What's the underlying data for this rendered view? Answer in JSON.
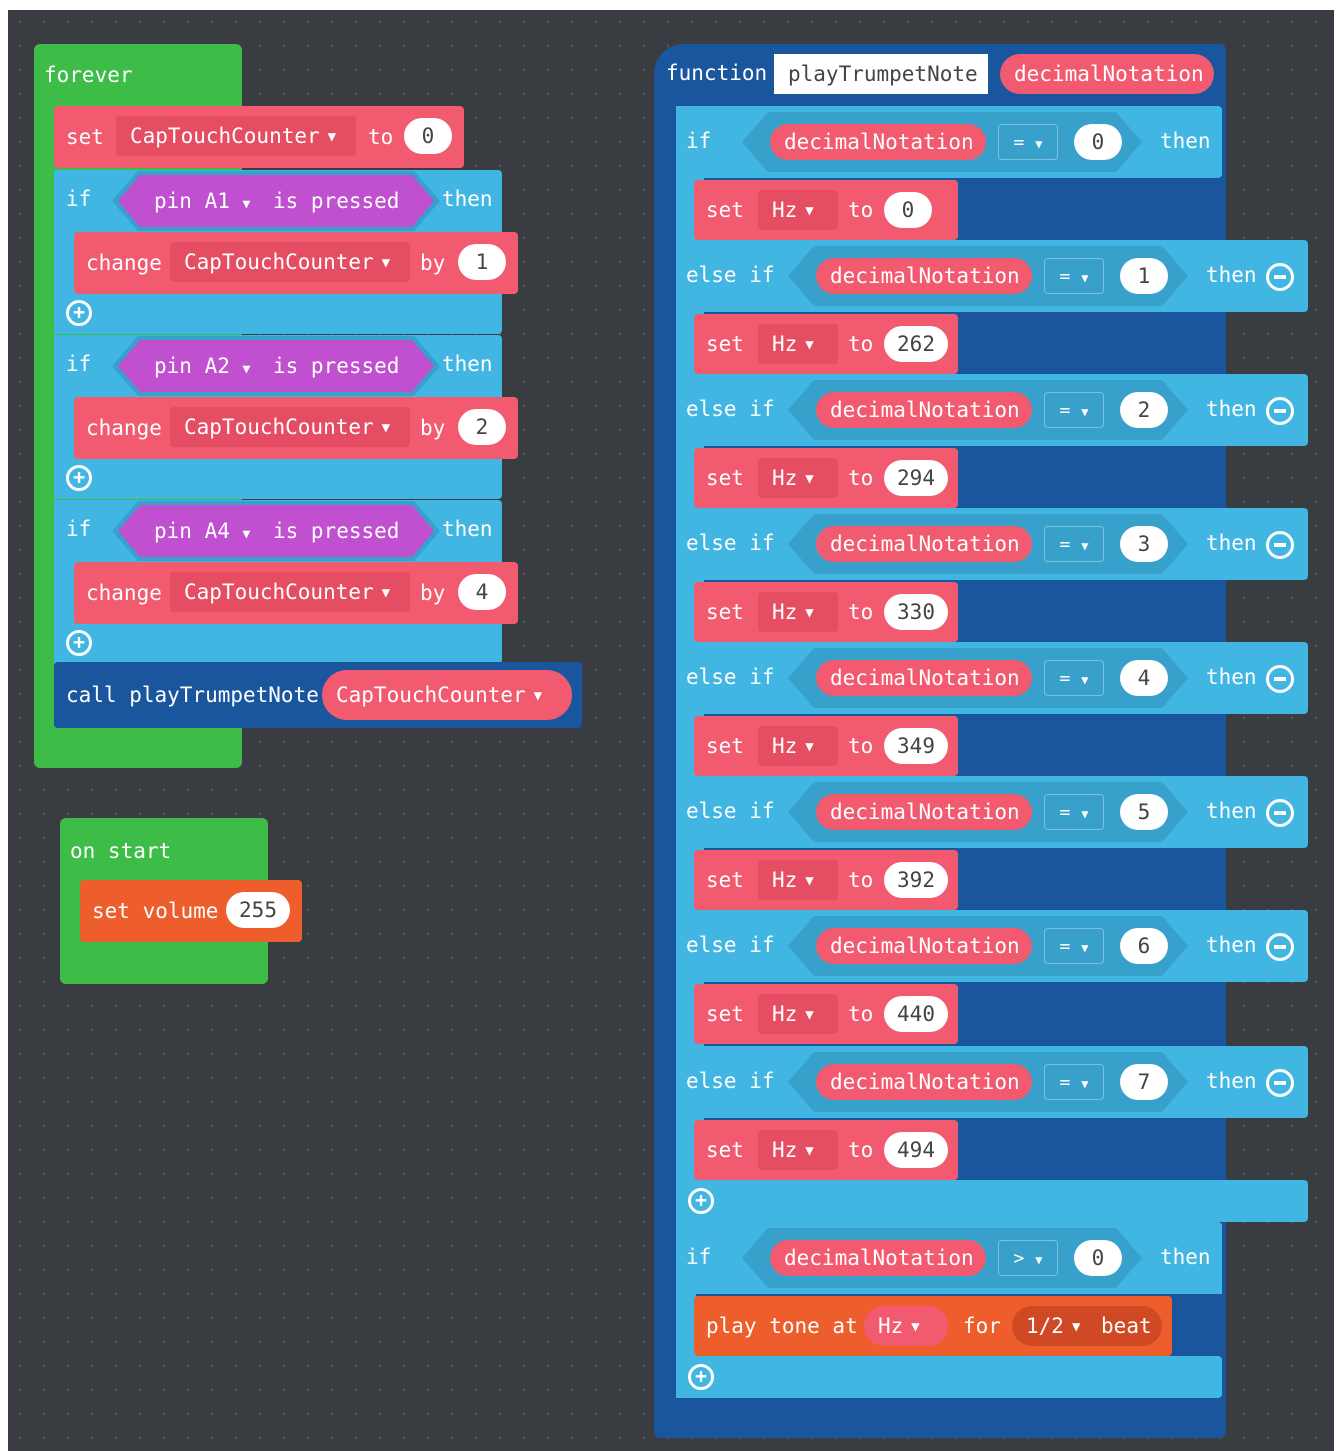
{
  "forever": {
    "label": "forever",
    "set_kw": "set",
    "set_var": "CapTouchCounter",
    "set_to": "to",
    "set_val": "0",
    "ifs": [
      {
        "if_kw": "if",
        "pin": "pin A1",
        "pressed": "is pressed",
        "then": "then",
        "change": "change",
        "var": "CapTouchCounter",
        "by": "by",
        "amount": "1"
      },
      {
        "if_kw": "if",
        "pin": "pin A2",
        "pressed": "is pressed",
        "then": "then",
        "change": "change",
        "var": "CapTouchCounter",
        "by": "by",
        "amount": "2"
      },
      {
        "if_kw": "if",
        "pin": "pin A4",
        "pressed": "is pressed",
        "then": "then",
        "change": "change",
        "var": "CapTouchCounter",
        "by": "by",
        "amount": "4"
      }
    ],
    "call_label": "call playTrumpetNote",
    "call_arg": "CapTouchCounter"
  },
  "on_start": {
    "label": "on start",
    "set_volume": "set volume",
    "volume": "255"
  },
  "function": {
    "kw": "function",
    "name": "playTrumpetNote",
    "param": "decimalNotation",
    "branches": [
      {
        "kw": "if",
        "var": "decimalNotation",
        "op": "=",
        "val": "0",
        "then": "then",
        "set": "set",
        "hz": "Hz",
        "to": "to",
        "freq": "0"
      },
      {
        "kw": "else if",
        "var": "decimalNotation",
        "op": "=",
        "val": "1",
        "then": "then",
        "set": "set",
        "hz": "Hz",
        "to": "to",
        "freq": "262"
      },
      {
        "kw": "else if",
        "var": "decimalNotation",
        "op": "=",
        "val": "2",
        "then": "then",
        "set": "set",
        "hz": "Hz",
        "to": "to",
        "freq": "294"
      },
      {
        "kw": "else if",
        "var": "decimalNotation",
        "op": "=",
        "val": "3",
        "then": "then",
        "set": "set",
        "hz": "Hz",
        "to": "to",
        "freq": "330"
      },
      {
        "kw": "else if",
        "var": "decimalNotation",
        "op": "=",
        "val": "4",
        "then": "then",
        "set": "set",
        "hz": "Hz",
        "to": "to",
        "freq": "349"
      },
      {
        "kw": "else if",
        "var": "decimalNotation",
        "op": "=",
        "val": "5",
        "then": "then",
        "set": "set",
        "hz": "Hz",
        "to": "to",
        "freq": "392"
      },
      {
        "kw": "else if",
        "var": "decimalNotation",
        "op": "=",
        "val": "6",
        "then": "then",
        "set": "set",
        "hz": "Hz",
        "to": "to",
        "freq": "440"
      },
      {
        "kw": "else if",
        "var": "decimalNotation",
        "op": "=",
        "val": "7",
        "then": "then",
        "set": "set",
        "hz": "Hz",
        "to": "to",
        "freq": "494"
      }
    ],
    "second_if": {
      "kw": "if",
      "var": "decimalNotation",
      "op": ">",
      "val": "0",
      "then": "then"
    },
    "play": {
      "play_kw": "play tone at",
      "hz": "Hz",
      "for": "for",
      "beat_val": "1/2",
      "beat": "beat"
    }
  },
  "colors": {
    "workspace": "#393d42",
    "event": "#3dbd48",
    "variables": "#f15a6f",
    "logic": "#41b6e3",
    "functions": "#1a569d",
    "input": "#c050cf",
    "music": "#ee5d2c"
  }
}
